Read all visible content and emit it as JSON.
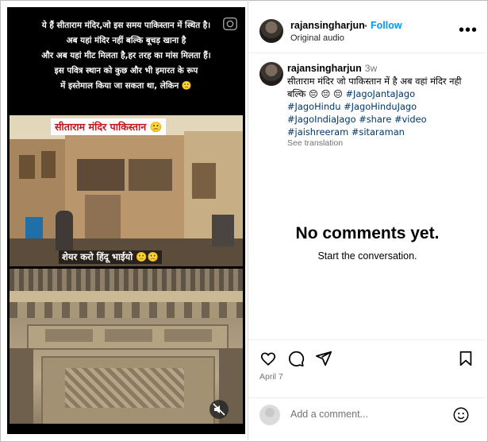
{
  "video": {
    "caption_lines": [
      "ये हैं सीताराम मंदिर,जो इस समय पाकिस्तान में स्थित है।",
      "अब यहां मंदिर नहीं बल्कि बूचड़ खाना है",
      "और अब यहां मीट मिलता है,हर तरह का मांस मिलता हैं।",
      "इस पवित्र स्थान को कुछ और भी इमारत के रूप",
      "में इस्तेमाल किया जा सकता था, लेकिन 🙁"
    ],
    "banner_text": "सीताराम मंदिर पाकिस्तान 🙁",
    "share_text": "शेयर करो हिंदू भाईयो 🙁🙁",
    "camera_icon": "camera-icon",
    "mute_icon": "muted-speaker-icon"
  },
  "header": {
    "username": "rajansingharjun",
    "separator": "•",
    "follow_label": "Follow",
    "audio_label": "Original audio",
    "more_icon": "more-options-icon"
  },
  "post_caption": {
    "username": "rajansingharjun",
    "time": "3w",
    "text": "सीताराम मंदिर जो पाकिस्तान में है अब वहां मंदिर नही बल्कि 😔 😔 😔",
    "hashtags": [
      "#JagoJantaJago",
      "#JagoHindu",
      "#JagoHinduJago",
      "#JagoIndiaJago",
      "#share",
      "#video",
      "#jaishreeram",
      "#sitaraman"
    ],
    "see_translation": "See translation"
  },
  "comments": {
    "empty_title": "No comments yet.",
    "empty_subtitle": "Start the conversation."
  },
  "actions": {
    "like_icon": "heart-icon",
    "comment_icon": "comment-icon",
    "share_icon": "send-icon",
    "save_icon": "bookmark-icon",
    "date": "April 7"
  },
  "add_comment": {
    "placeholder": "Add a comment...",
    "emoji_icon": "emoji-icon"
  }
}
